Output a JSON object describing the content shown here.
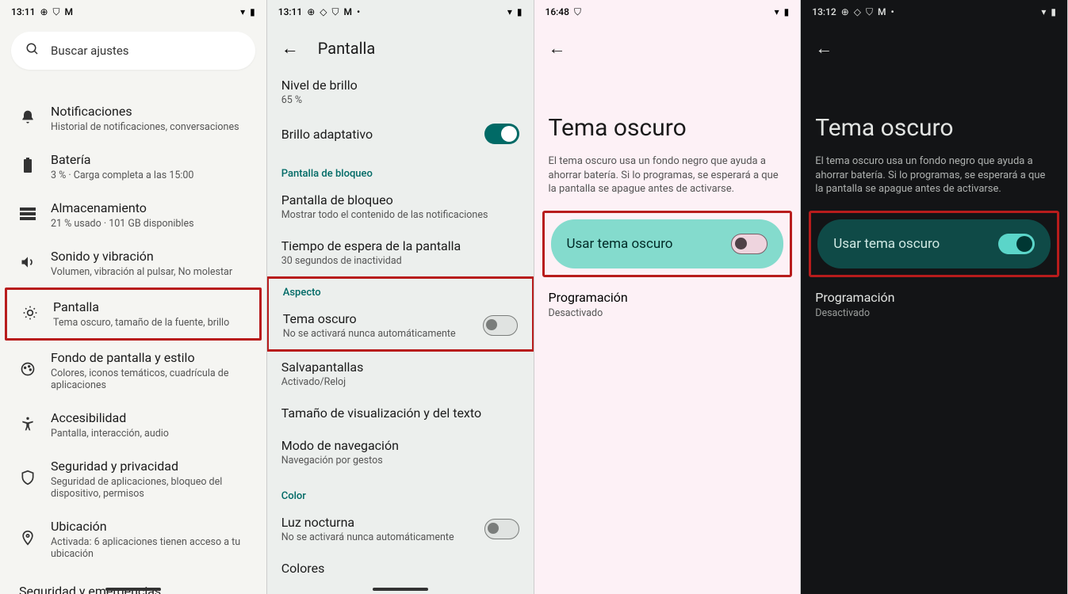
{
  "p1": {
    "status_time": "13:11",
    "search_placeholder": "Buscar ajustes",
    "items": [
      {
        "title": "",
        "sub": ""
      },
      {
        "title": "Notificaciones",
        "sub": "Historial de notificaciones, conversaciones"
      },
      {
        "title": "Batería",
        "sub": "3 % · Carga completa a las 15:00"
      },
      {
        "title": "Almacenamiento",
        "sub": "21 % usado · 101 GB disponibles"
      },
      {
        "title": "Sonido y vibración",
        "sub": "Volumen, vibración al pulsar, No molestar"
      },
      {
        "title": "Pantalla",
        "sub": "Tema oscuro, tamaño de la fuente, brillo"
      },
      {
        "title": "Fondo de pantalla y estilo",
        "sub": "Colores, iconos temáticos, cuadrícula de aplicaciones"
      },
      {
        "title": "Accesibilidad",
        "sub": "Pantalla, interacción, audio"
      },
      {
        "title": "Seguridad y privacidad",
        "sub": "Seguridad de aplicaciones, bloqueo del dispositivo, permisos"
      },
      {
        "title": "Ubicación",
        "sub": "Activada: 6 aplicaciones tienen acceso a tu ubicación"
      }
    ],
    "cut": "Seguridad y emergencias"
  },
  "p2": {
    "status_time": "13:11",
    "header": "Pantalla",
    "brightness_title": "Nivel de brillo",
    "brightness_sub": "65 %",
    "adaptive": "Brillo adaptativo",
    "section_lock": "Pantalla de bloqueo",
    "lock_title": "Pantalla de bloqueo",
    "lock_sub": "Mostrar todo el contenido de las notificaciones",
    "timeout_title": "Tiempo de espera de la pantalla",
    "timeout_sub": "30 segundos de inactividad",
    "section_aspect": "Aspecto",
    "dark_title": "Tema oscuro",
    "dark_sub": "No se activará nunca automáticamente",
    "saver_title": "Salvapantallas",
    "saver_sub": "Activado/Reloj",
    "display_title": "Tamaño de visualización y del texto",
    "nav_title": "Modo de navegación",
    "nav_sub": "Navegación por gestos",
    "section_color": "Color",
    "night_title": "Luz nocturna",
    "night_sub": "No se activará nunca automáticamente",
    "colors": "Colores"
  },
  "p3": {
    "status_time": "16:48",
    "title": "Tema oscuro",
    "desc": "El tema oscuro usa un fondo negro que ayuda a ahorrar batería. Si lo programas, se esperará a que la pantalla se apague antes de activarse.",
    "toggle_label": "Usar tema oscuro",
    "sched_title": "Programación",
    "sched_sub": "Desactivado"
  },
  "p4": {
    "status_time": "13:12",
    "title": "Tema oscuro",
    "desc": "El tema oscuro usa un fondo negro que ayuda a ahorrar batería. Si lo programas, se esperará a que la pantalla se apague antes de activarse.",
    "toggle_label": "Usar tema oscuro",
    "sched_title": "Programación",
    "sched_sub": "Desactivado"
  }
}
